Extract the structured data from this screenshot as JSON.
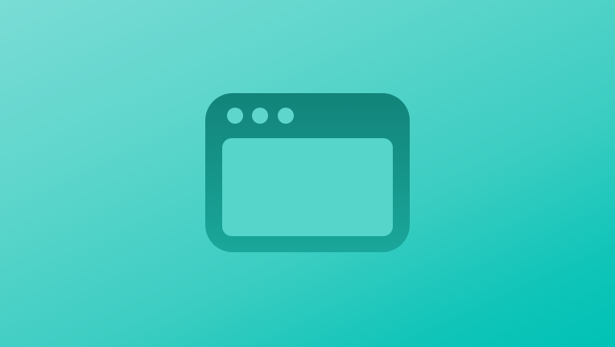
{
  "scene": {
    "background_colors": [
      "#7adcd5",
      "#5fd6cc",
      "#3ccdc2",
      "#10c4b8",
      "#00c2b6"
    ],
    "icon": {
      "name": "browser-window-icon",
      "frame_color_top": "#128379",
      "frame_color_bottom": "#1aa79b",
      "dot_color": "#5fd6cc",
      "window_color": "#56d5ca",
      "dots": [
        "window-dot",
        "window-dot",
        "window-dot"
      ]
    }
  }
}
